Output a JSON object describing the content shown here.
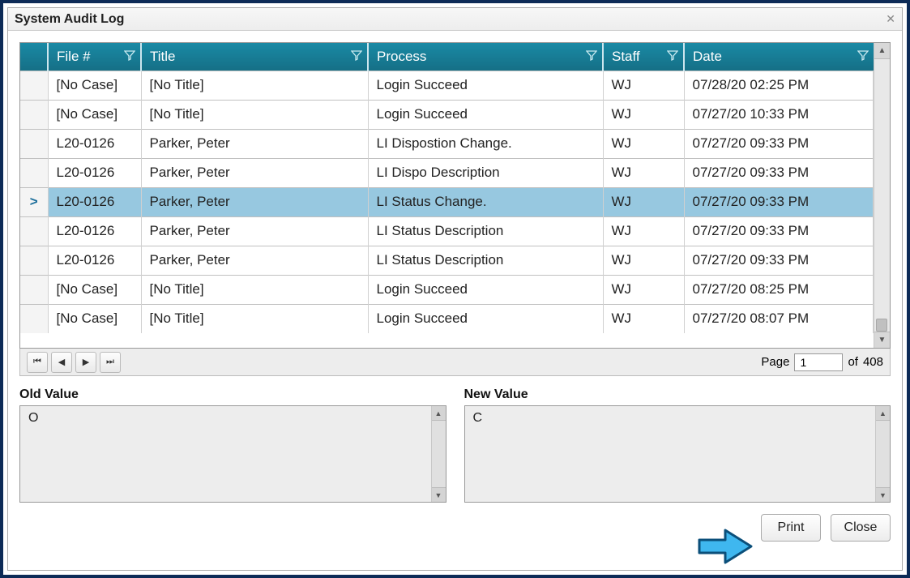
{
  "window": {
    "title": "System Audit Log"
  },
  "columns": {
    "file": "File #",
    "title": "Title",
    "process": "Process",
    "staff": "Staff",
    "date": "Date"
  },
  "rows": [
    {
      "file": "[No Case]",
      "title": "[No Title]",
      "process": "Login Succeed",
      "staff": "WJ",
      "date": "07/28/20 02:25 PM",
      "selected": false
    },
    {
      "file": "[No Case]",
      "title": "[No Title]",
      "process": "Login Succeed",
      "staff": "WJ",
      "date": "07/27/20 10:33 PM",
      "selected": false
    },
    {
      "file": "L20-0126",
      "title": "Parker, Peter",
      "process": "LI Dispostion Change.",
      "staff": "WJ",
      "date": "07/27/20 09:33 PM",
      "selected": false
    },
    {
      "file": "L20-0126",
      "title": "Parker, Peter",
      "process": "LI Dispo Description",
      "staff": "WJ",
      "date": "07/27/20 09:33 PM",
      "selected": false
    },
    {
      "file": "L20-0126",
      "title": "Parker, Peter",
      "process": "LI Status Change.",
      "staff": "WJ",
      "date": "07/27/20 09:33 PM",
      "selected": true
    },
    {
      "file": "L20-0126",
      "title": "Parker, Peter",
      "process": "LI Status Description",
      "staff": "WJ",
      "date": "07/27/20 09:33 PM",
      "selected": false
    },
    {
      "file": "L20-0126",
      "title": "Parker, Peter",
      "process": "LI Status Description",
      "staff": "WJ",
      "date": "07/27/20 09:33 PM",
      "selected": false
    },
    {
      "file": "[No Case]",
      "title": "[No Title]",
      "process": "Login Succeed",
      "staff": "WJ",
      "date": "07/27/20 08:25 PM",
      "selected": false
    },
    {
      "file": "[No Case]",
      "title": "[No Title]",
      "process": "Login Succeed",
      "staff": "WJ",
      "date": "07/27/20 08:07 PM",
      "selected": false
    }
  ],
  "pager": {
    "page_label": "Page",
    "page_value": "1",
    "of_label": "of",
    "total_pages": "408"
  },
  "values": {
    "old_label": "Old Value",
    "old_text": "O",
    "new_label": "New Value",
    "new_text": "C"
  },
  "buttons": {
    "print": "Print",
    "close": "Close"
  }
}
